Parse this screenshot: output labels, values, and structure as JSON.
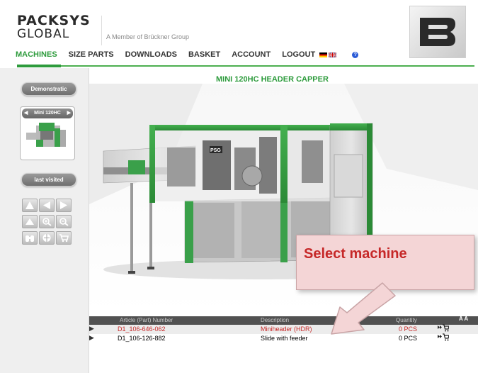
{
  "header": {
    "logo_line1": "PACKSYS",
    "logo_line2": "GLOBAL",
    "member_text": "A Member of Brückner Group"
  },
  "nav": {
    "items": [
      {
        "label": "MACHINES",
        "active": true
      },
      {
        "label": "SIZE PARTS"
      },
      {
        "label": "DOWNLOADS"
      },
      {
        "label": "BASKET"
      },
      {
        "label": "ACCOUNT"
      },
      {
        "label": "LOGOUT"
      }
    ],
    "help_icon": "?"
  },
  "sidebar": {
    "demonstration_label": "Demonstratic",
    "machine_label": "Mini 120HC",
    "last_visited_label": "last visited"
  },
  "main": {
    "title": "MINI 120HC HEADER CAPPER"
  },
  "table": {
    "headers": {
      "article": "Article (Part) Number",
      "description": "Description",
      "quantity": "Quantity",
      "font_size_control": "A A"
    },
    "rows": [
      {
        "article": "D1_106-646-062",
        "description": "Miniheader (HDR)",
        "quantity": "0 PCS",
        "selected": true
      },
      {
        "article": "D1_106-126-882",
        "description": "Slide with feeder",
        "quantity": "0 PCS",
        "selected": false
      }
    ]
  },
  "callout": {
    "text": "Select machine"
  },
  "colors": {
    "accent_green": "#2d9b3c",
    "selected_red": "#c62828",
    "callout_bg": "#f4d5d6"
  }
}
